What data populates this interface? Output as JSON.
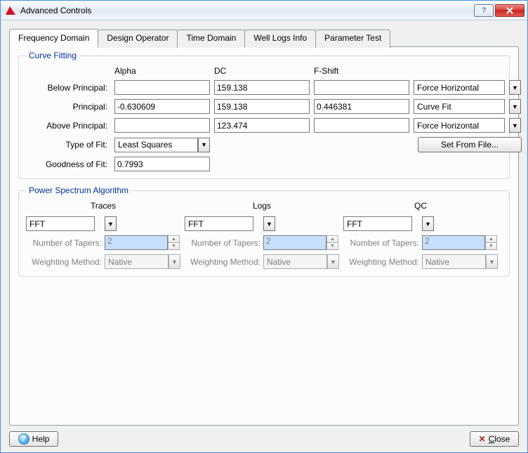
{
  "window": {
    "title": "Advanced Controls"
  },
  "tabs": [
    "Frequency Domain",
    "Design Operator",
    "Time Domain",
    "Well Logs Info",
    "Parameter Test"
  ],
  "curve_fitting": {
    "legend": "Curve Fitting",
    "headers": {
      "alpha": "Alpha",
      "dc": "DC",
      "fshift": "F-Shift"
    },
    "labels": {
      "below": "Below Principal:",
      "principal": "Principal:",
      "above": "Above Principal:",
      "type_of_fit": "Type of Fit:",
      "goodness": "Goodness of Fit:"
    },
    "rows": {
      "below": {
        "alpha": "",
        "dc": "159.138",
        "fshift": "",
        "mode": "Force Horizontal"
      },
      "principal": {
        "alpha": "-0.630609",
        "dc": "159.138",
        "fshift": "0.446381",
        "mode": "Curve Fit"
      },
      "above": {
        "alpha": "",
        "dc": "123.474",
        "fshift": "",
        "mode": "Force Horizontal"
      }
    },
    "type_of_fit": "Least Squares",
    "set_from_file_label": "Set From File...",
    "goodness_value": "0.7993"
  },
  "psa": {
    "legend": "Power Spectrum Algorithm",
    "columns": {
      "traces": "Traces",
      "logs": "Logs",
      "qc": "QC"
    },
    "labels": {
      "tapers": "Number of Tapers:",
      "weighting": "Weighting Method:"
    },
    "cols": {
      "traces": {
        "algo": "FFT",
        "tapers": "2",
        "weighting": "Native"
      },
      "logs": {
        "algo": "FFT",
        "tapers": "2",
        "weighting": "Native"
      },
      "qc": {
        "algo": "FFT",
        "tapers": "2",
        "weighting": "Native"
      }
    }
  },
  "footer": {
    "help": "Help",
    "close_prefix": "C",
    "close_stem": "lose"
  }
}
